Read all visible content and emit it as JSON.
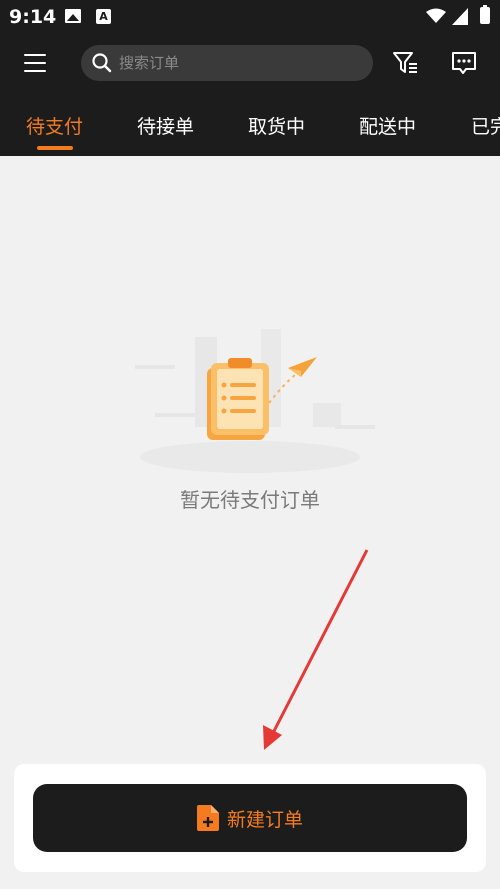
{
  "status_bar": {
    "time": "9:14",
    "a_icon_letter": "A"
  },
  "header": {
    "search_placeholder": "搜索订单"
  },
  "tabs": [
    {
      "label": "待支付",
      "active": true
    },
    {
      "label": "待接单",
      "active": false
    },
    {
      "label": "取货中",
      "active": false
    },
    {
      "label": "配送中",
      "active": false
    },
    {
      "label": "已完",
      "active": false
    }
  ],
  "empty_state": {
    "message": "暂无待支付订单"
  },
  "bottom": {
    "new_order_label": "新建订单"
  },
  "colors": {
    "accent": "#f47b20",
    "header_bg": "#1c1c1c",
    "page_bg": "#f1f1f1",
    "arrow": "#e53935"
  },
  "icons": [
    "menu-icon",
    "search-icon",
    "filter-icon",
    "message-icon",
    "clipboard-icon",
    "paper-plane-icon",
    "add-document-icon"
  ]
}
